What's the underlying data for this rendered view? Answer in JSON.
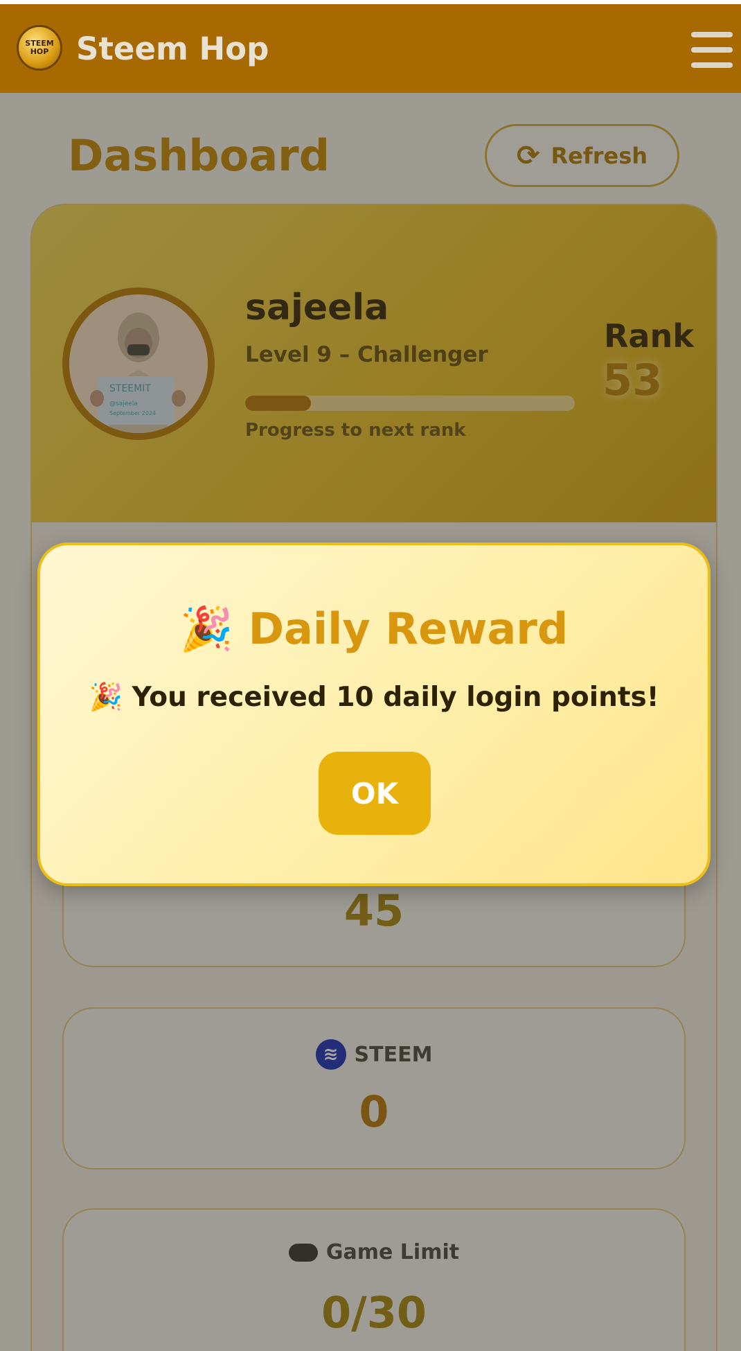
{
  "app": {
    "title": "Steem Hop",
    "logo_text_top": "STEEM",
    "logo_text_bottom": "HOP"
  },
  "page": {
    "title": "Dashboard",
    "refresh_label": "Refresh"
  },
  "profile": {
    "username": "sajeela",
    "level": "Level 9 – Challenger",
    "progress_label": "Progress to next rank",
    "progress_fraction": 0.2,
    "rank_label": "Rank",
    "rank_value": "53"
  },
  "stats": [
    {
      "label": "",
      "value": "45",
      "icon": ""
    },
    {
      "label": "STEEM",
      "value": "0",
      "icon": "steem-icon"
    },
    {
      "label": "Game Limit",
      "value": "0/30",
      "icon": "gamepad-icon"
    }
  ],
  "modal": {
    "title_emoji": "🎉",
    "title": "Daily Reward",
    "message": "🎉 You received 10 daily login points!",
    "ok_label": "OK"
  },
  "colors": {
    "header": "#a86a00",
    "accent": "#e8b10b",
    "rank": "#b8840a",
    "modal_border": "#ebbd17"
  }
}
